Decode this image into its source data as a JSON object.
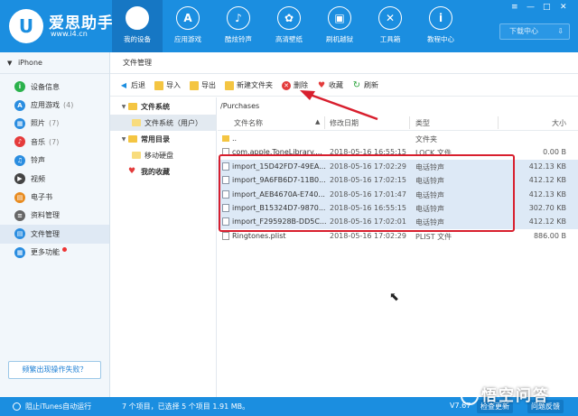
{
  "app": {
    "brand": "爱思助手",
    "url": "www.i4.cn",
    "logo_glyph": "U"
  },
  "nav": [
    {
      "label": "我的设备",
      "icon": "apple-icon",
      "glyph": "",
      "active": true
    },
    {
      "label": "应用游戏",
      "icon": "app-store-icon",
      "glyph": "A",
      "active": false
    },
    {
      "label": "酷炫铃声",
      "icon": "bell-icon",
      "glyph": "♪",
      "active": false
    },
    {
      "label": "高清壁纸",
      "icon": "flower-icon",
      "glyph": "✿",
      "active": false
    },
    {
      "label": "刷机越狱",
      "icon": "box-icon",
      "glyph": "▣",
      "active": false
    },
    {
      "label": "工具箱",
      "icon": "tools-icon",
      "glyph": "✕",
      "active": false
    },
    {
      "label": "教程中心",
      "icon": "info-icon",
      "glyph": "i",
      "active": false
    }
  ],
  "window_controls": {
    "minimize": "—",
    "maximize": "□",
    "close": "✕",
    "menu": "≡"
  },
  "download": {
    "label": "下载中心",
    "chevron": "⇩"
  },
  "sidebar": {
    "device": "iPhone",
    "caret": "▼",
    "items": [
      {
        "label": "设备信息",
        "count": "",
        "icon": "info-circle-icon",
        "color": "#2bb24c",
        "glyph": "i"
      },
      {
        "label": "应用游戏",
        "count": "(4)",
        "icon": "app-store-icon",
        "color": "#2a8de0",
        "glyph": "A"
      },
      {
        "label": "照片",
        "count": "(7)",
        "icon": "photo-icon",
        "color": "#2a8de0",
        "glyph": "▦"
      },
      {
        "label": "音乐",
        "count": "(7)",
        "icon": "music-icon",
        "color": "#e53b3b",
        "glyph": "♪"
      },
      {
        "label": "铃声",
        "count": "",
        "icon": "bell-icon",
        "color": "#2a8de0",
        "glyph": "♫"
      },
      {
        "label": "视频",
        "count": "",
        "icon": "video-icon",
        "color": "#444",
        "glyph": "▶"
      },
      {
        "label": "电子书",
        "count": "",
        "icon": "book-icon",
        "color": "#e88b1f",
        "glyph": "▤"
      },
      {
        "label": "资料管理",
        "count": "",
        "icon": "document-icon",
        "color": "#666",
        "glyph": "≡"
      },
      {
        "label": "文件管理",
        "count": "",
        "icon": "folder-icon",
        "color": "#2a8de0",
        "glyph": "▤",
        "active": true
      },
      {
        "label": "更多功能",
        "count": "",
        "icon": "grid-icon",
        "color": "#2a8de0",
        "glyph": "▦",
        "dot": true
      }
    ],
    "fail_button": "频繁出现操作失败？"
  },
  "tab": "文件管理",
  "toolbar": {
    "back": "后退",
    "import": "导入",
    "export": "导出",
    "new_folder": "新建文件夹",
    "delete": "删除",
    "favorite": "收藏",
    "refresh": "刷新"
  },
  "tree": {
    "fs_root": "文件系统",
    "fs_user": "文件系统（用户）",
    "common": "常用目录",
    "mobile_disk": "移动硬盘",
    "favorites": "我的收藏"
  },
  "path": "/Purchases",
  "columns": {
    "name": "文件名称",
    "date": "修改日期",
    "type": "类型",
    "size": "大小"
  },
  "files": [
    {
      "name": "..",
      "date": "",
      "type": "文件夹",
      "size": "",
      "kind": "folder",
      "selected": false
    },
    {
      "name": "com.apple.ToneLibrary....",
      "date": "2018-05-16 16:55:15",
      "type": "LOCK 文件",
      "size": "0.00 B",
      "kind": "file",
      "selected": false
    },
    {
      "name": "import_15D42FD7-49EA...",
      "date": "2018-05-16 17:02:29",
      "type": "电话铃声",
      "size": "412.13 KB",
      "kind": "music",
      "selected": true
    },
    {
      "name": "import_9A6FB6D7-11B0...",
      "date": "2018-05-16 17:02:15",
      "type": "电话铃声",
      "size": "412.12 KB",
      "kind": "music",
      "selected": true
    },
    {
      "name": "import_AEB4670A-E740...",
      "date": "2018-05-16 17:01:47",
      "type": "电话铃声",
      "size": "412.13 KB",
      "kind": "music",
      "selected": true
    },
    {
      "name": "import_B15324D7-9870...",
      "date": "2018-05-16 16:55:15",
      "type": "电话铃声",
      "size": "302.70 KB",
      "kind": "music",
      "selected": true
    },
    {
      "name": "import_F295928B-DD5C...",
      "date": "2018-05-16 17:02:01",
      "type": "电话铃声",
      "size": "412.12 KB",
      "kind": "music",
      "selected": true
    },
    {
      "name": "Ringtones.plist",
      "date": "2018-05-16 17:02:29",
      "type": "PLIST 文件",
      "size": "886.00 B",
      "kind": "file",
      "selected": false
    }
  ],
  "status": {
    "itunes": "阻止iTunes自动运行",
    "summary": "7 个项目，已选择 5 个项目 1.91 MB。",
    "version": "V7.67",
    "check_update": "检查更新",
    "feedback": "问题反馈"
  },
  "watermark": "悟空问答"
}
